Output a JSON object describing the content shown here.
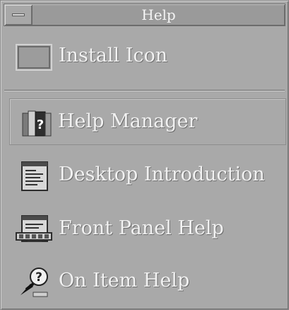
{
  "window": {
    "title": "Help"
  },
  "items": {
    "install_icon": "Install Icon",
    "help_manager": "Help Manager",
    "desktop_intro": "Desktop Introduction",
    "front_panel": "Front Panel Help",
    "on_item": "On Item Help"
  },
  "colors": {
    "background": "#a9a9a9",
    "text": "#f1f1f1",
    "title_text": "#f4f4f4"
  }
}
